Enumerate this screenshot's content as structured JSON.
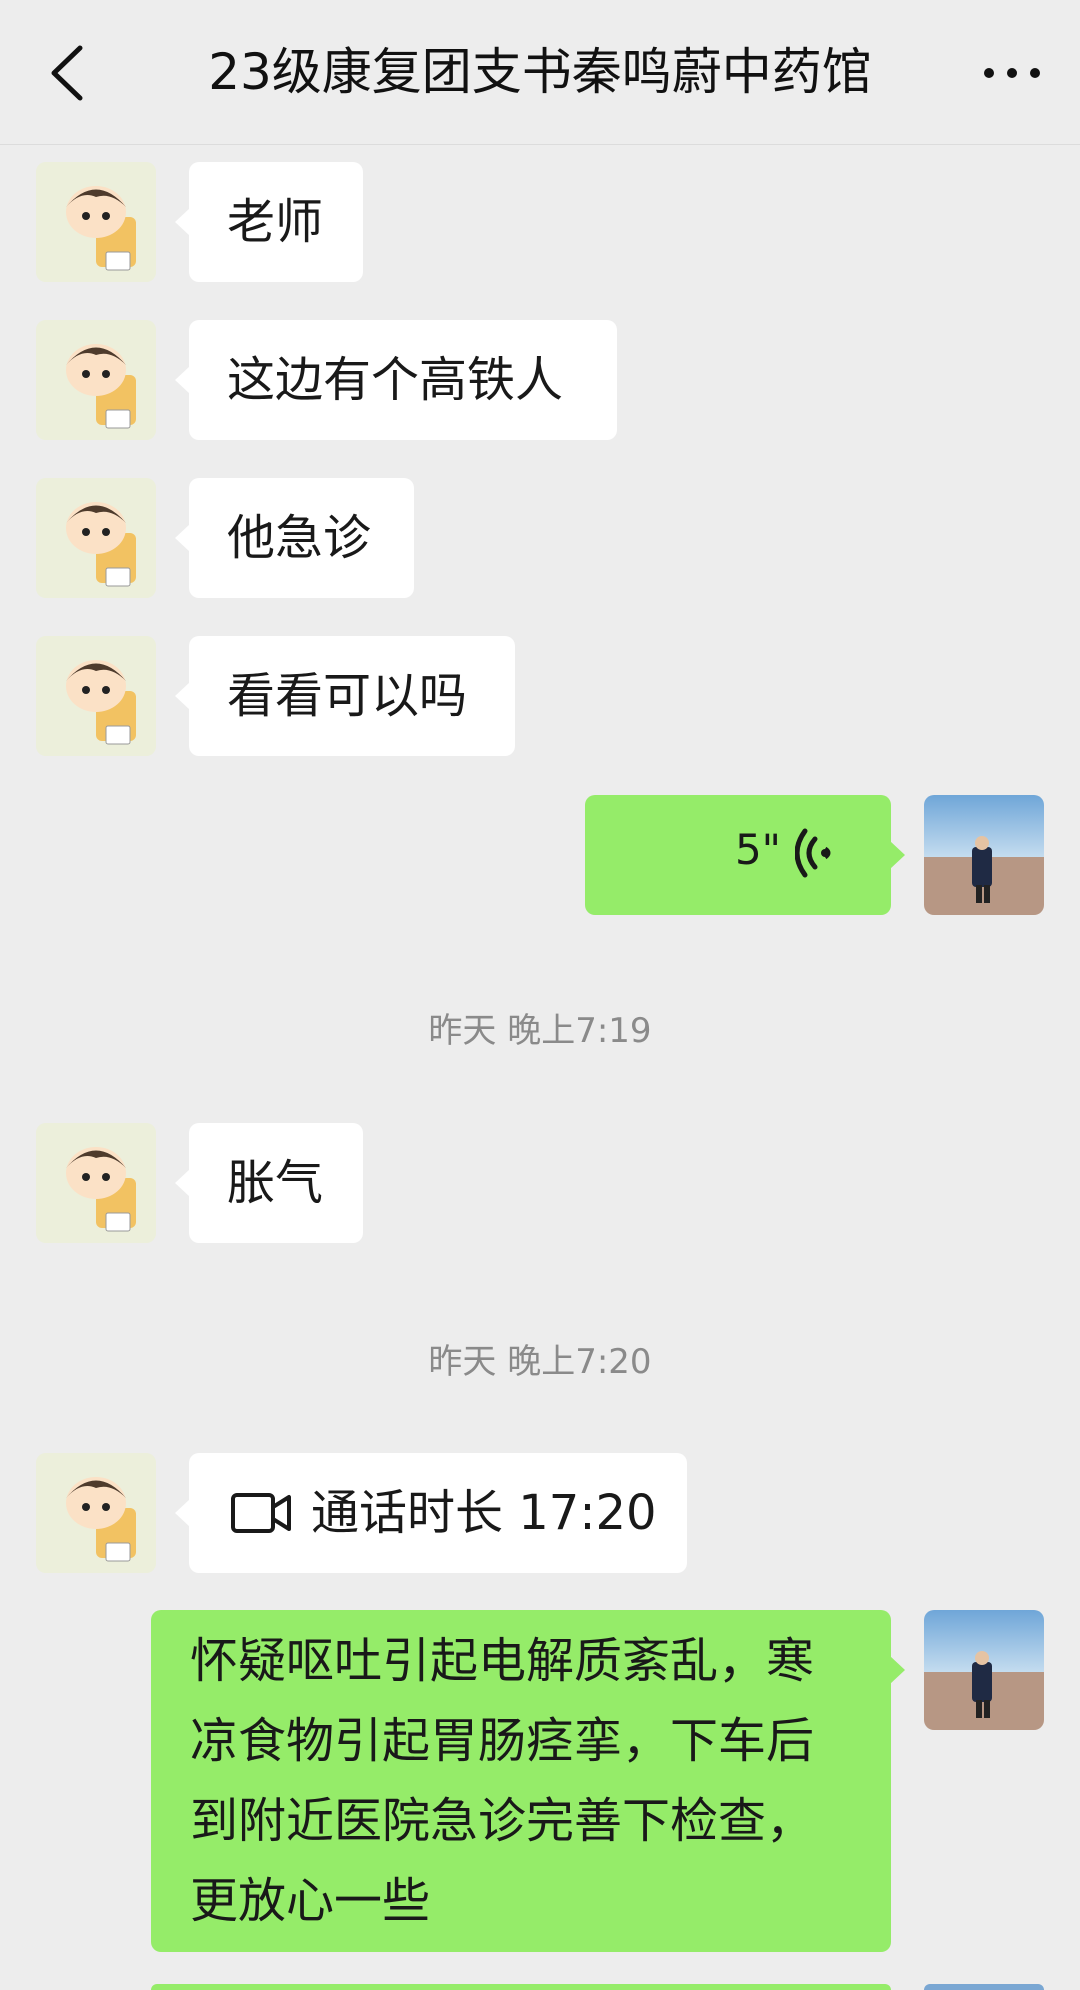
{
  "header": {
    "title": "23级康复团支书秦鸣蔚中药馆",
    "back_icon": "chevron-left-icon",
    "more_icon": "more-dots-icon"
  },
  "messages": [
    {
      "text": "老师"
    },
    {
      "text": "这边有个高铁人"
    },
    {
      "text": "他急诊"
    },
    {
      "text": "看看可以吗"
    }
  ],
  "voice_message": {
    "duration": "5\"",
    "icon": "voice-wave-icon"
  },
  "timestamps": [
    "昨天 晚上7:19",
    "昨天 晚上7:20"
  ],
  "message_after_7_19": {
    "text": "胀气"
  },
  "call_record": {
    "icon": "video-call-icon",
    "text": "通话时长 17:20"
  },
  "reply": {
    "text": "怀疑呕吐引起电解质紊乱，寒凉食物引起胃肠痉挛，下车后到附近医院急诊完善下检查，更放心一些"
  },
  "colors": {
    "background": "#ededed",
    "self_bubble": "#95ec69",
    "other_bubble": "#ffffff",
    "timestamp": "#8a8a8a"
  }
}
